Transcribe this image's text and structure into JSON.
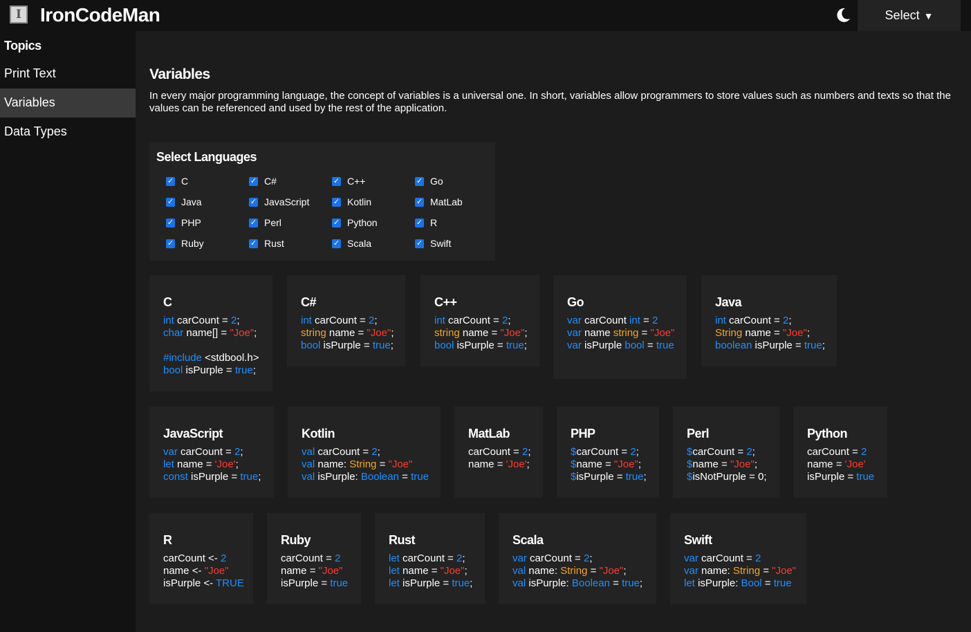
{
  "header": {
    "logo_letter": "I",
    "site_title": "IronCodeMan",
    "select_label": "Select",
    "select_caret": "▼",
    "theme_icon": "moon-icon"
  },
  "sidebar": {
    "heading": "Topics",
    "items": [
      {
        "label": "Print Text",
        "active": false
      },
      {
        "label": "Variables",
        "active": true
      },
      {
        "label": "Data Types",
        "active": false
      }
    ]
  },
  "main": {
    "title": "Variables",
    "intro": "In every major programming language, the concept of variables is a universal one. In short, variables allow programmers to store values such as numbers and texts so that the values can be referenced and used by the rest of the application."
  },
  "languages": {
    "title": "Select Languages",
    "options": [
      {
        "label": "C",
        "checked": true
      },
      {
        "label": "C#",
        "checked": true
      },
      {
        "label": "C++",
        "checked": true
      },
      {
        "label": "Go",
        "checked": true
      },
      {
        "label": "Java",
        "checked": true
      },
      {
        "label": "JavaScript",
        "checked": true
      },
      {
        "label": "Kotlin",
        "checked": true
      },
      {
        "label": "MatLab",
        "checked": true
      },
      {
        "label": "PHP",
        "checked": true
      },
      {
        "label": "Perl",
        "checked": true
      },
      {
        "label": "Python",
        "checked": true
      },
      {
        "label": "R",
        "checked": true
      },
      {
        "label": "Ruby",
        "checked": true
      },
      {
        "label": "Rust",
        "checked": true
      },
      {
        "label": "Scala",
        "checked": true
      },
      {
        "label": "Swift",
        "checked": true
      }
    ]
  },
  "colors": {
    "keyword": "#1e90ff",
    "string": "#ff3b30",
    "type": "#f5a623",
    "checkbox": "#1a73e8"
  },
  "cards": [
    {
      "name": "C",
      "lines": [
        [
          [
            "kw",
            "int"
          ],
          [
            "t",
            " carCount = "
          ],
          [
            "kw",
            "2"
          ],
          [
            "t",
            ";"
          ]
        ],
        [
          [
            "kw",
            "char"
          ],
          [
            "t",
            " name[] = "
          ],
          [
            "str",
            "\"Joe\""
          ],
          [
            "t",
            ";"
          ]
        ],
        [],
        [
          [
            "kw",
            "#include"
          ],
          [
            "t",
            " <stdbool.h>"
          ]
        ],
        [
          [
            "kw",
            "bool"
          ],
          [
            "t",
            " isPurple = "
          ],
          [
            "kw",
            "true"
          ],
          [
            "t",
            ";"
          ]
        ]
      ]
    },
    {
      "name": "C#",
      "lines": [
        [
          [
            "kw",
            "int"
          ],
          [
            "t",
            " carCount = "
          ],
          [
            "kw",
            "2"
          ],
          [
            "t",
            ";"
          ]
        ],
        [
          [
            "typ",
            "string"
          ],
          [
            "t",
            " name = "
          ],
          [
            "str",
            "\"Joe\""
          ],
          [
            "t",
            ";"
          ]
        ],
        [
          [
            "kw",
            "bool"
          ],
          [
            "t",
            " isPurple = "
          ],
          [
            "kw",
            "true"
          ],
          [
            "t",
            ";"
          ]
        ]
      ]
    },
    {
      "name": "C++",
      "lines": [
        [
          [
            "kw",
            "int"
          ],
          [
            "t",
            " carCount = "
          ],
          [
            "kw",
            "2"
          ],
          [
            "t",
            ";"
          ]
        ],
        [
          [
            "typ",
            "string"
          ],
          [
            "t",
            " name = "
          ],
          [
            "str",
            "\"Joe\""
          ],
          [
            "t",
            ";"
          ]
        ],
        [
          [
            "kw",
            "bool"
          ],
          [
            "t",
            " isPurple = "
          ],
          [
            "kw",
            "true"
          ],
          [
            "t",
            ";"
          ]
        ]
      ]
    },
    {
      "name": "Go",
      "lines": [
        [
          [
            "kw",
            "var"
          ],
          [
            "t",
            " carCount "
          ],
          [
            "kw",
            "int"
          ],
          [
            "t",
            " = "
          ],
          [
            "kw",
            "2"
          ]
        ],
        [
          [
            "kw",
            "var"
          ],
          [
            "t",
            " name "
          ],
          [
            "typ",
            "string"
          ],
          [
            "t",
            " = "
          ],
          [
            "str",
            "\"Joe\""
          ]
        ],
        [
          [
            "kw",
            "var"
          ],
          [
            "t",
            " isPurple "
          ],
          [
            "kw",
            "bool"
          ],
          [
            "t",
            " = "
          ],
          [
            "kw",
            "true"
          ]
        ]
      ]
    },
    {
      "name": "Java",
      "lines": [
        [
          [
            "kw",
            "int"
          ],
          [
            "t",
            " carCount = "
          ],
          [
            "kw",
            "2"
          ],
          [
            "t",
            ";"
          ]
        ],
        [
          [
            "typ",
            "String"
          ],
          [
            "t",
            " name = "
          ],
          [
            "str",
            "\"Joe\""
          ],
          [
            "t",
            ";"
          ]
        ],
        [
          [
            "kw",
            "boolean"
          ],
          [
            "t",
            " isPurple = "
          ],
          [
            "kw",
            "true"
          ],
          [
            "t",
            ";"
          ]
        ]
      ]
    },
    {
      "name": "JavaScript",
      "lines": [
        [
          [
            "kw",
            "var"
          ],
          [
            "t",
            " carCount = "
          ],
          [
            "kw",
            "2"
          ],
          [
            "t",
            ";"
          ]
        ],
        [
          [
            "kw",
            "let"
          ],
          [
            "t",
            " name = "
          ],
          [
            "str",
            "'Joe'"
          ],
          [
            "t",
            ";"
          ]
        ],
        [
          [
            "kw",
            "const"
          ],
          [
            "t",
            " isPurple = "
          ],
          [
            "kw",
            "true"
          ],
          [
            "t",
            ";"
          ]
        ]
      ]
    },
    {
      "name": "Kotlin",
      "lines": [
        [
          [
            "kw",
            "val"
          ],
          [
            "t",
            " carCount = "
          ],
          [
            "kw",
            "2"
          ],
          [
            "t",
            ";"
          ]
        ],
        [
          [
            "kw",
            "val"
          ],
          [
            "t",
            " name: "
          ],
          [
            "typ",
            "String"
          ],
          [
            "t",
            " = "
          ],
          [
            "str",
            "\"Joe\""
          ]
        ],
        [
          [
            "kw",
            "val"
          ],
          [
            "t",
            " isPurple: "
          ],
          [
            "kw",
            "Boolean"
          ],
          [
            "t",
            " = "
          ],
          [
            "kw",
            "true"
          ]
        ]
      ]
    },
    {
      "name": "MatLab",
      "lines": [
        [
          [
            "t",
            "carCount = "
          ],
          [
            "kw",
            "2"
          ],
          [
            "t",
            ";"
          ]
        ],
        [
          [
            "t",
            "name = "
          ],
          [
            "str",
            "'Joe'"
          ],
          [
            "t",
            ";"
          ]
        ]
      ]
    },
    {
      "name": "PHP",
      "lines": [
        [
          [
            "kw",
            "$"
          ],
          [
            "t",
            "carCount = "
          ],
          [
            "kw",
            "2"
          ],
          [
            "t",
            ";"
          ]
        ],
        [
          [
            "kw",
            "$"
          ],
          [
            "t",
            "name = "
          ],
          [
            "str",
            "\"Joe\""
          ],
          [
            "t",
            ";"
          ]
        ],
        [
          [
            "kw",
            "$"
          ],
          [
            "t",
            "isPurple = "
          ],
          [
            "kw",
            "true"
          ],
          [
            "t",
            ";"
          ]
        ]
      ]
    },
    {
      "name": "Perl",
      "lines": [
        [
          [
            "kw",
            "$"
          ],
          [
            "t",
            "carCount = "
          ],
          [
            "kw",
            "2"
          ],
          [
            "t",
            ";"
          ]
        ],
        [
          [
            "kw",
            "$"
          ],
          [
            "t",
            "name = "
          ],
          [
            "str",
            "\"Joe\""
          ],
          [
            "t",
            ";"
          ]
        ],
        [
          [
            "kw",
            "$"
          ],
          [
            "t",
            "isNotPurple = 0;"
          ]
        ]
      ]
    },
    {
      "name": "Python",
      "lines": [
        [
          [
            "t",
            "carCount = "
          ],
          [
            "kw",
            "2"
          ]
        ],
        [
          [
            "t",
            "name = "
          ],
          [
            "str",
            "'Joe'"
          ]
        ],
        [
          [
            "t",
            "isPurple = "
          ],
          [
            "kw",
            "true"
          ]
        ]
      ]
    },
    {
      "name": "R",
      "lines": [
        [
          [
            "t",
            "carCount <- "
          ],
          [
            "kw",
            "2"
          ]
        ],
        [
          [
            "t",
            "name <- "
          ],
          [
            "str",
            "\"Joe\""
          ]
        ],
        [
          [
            "t",
            "isPurple <- "
          ],
          [
            "kw",
            "TRUE"
          ]
        ]
      ]
    },
    {
      "name": "Ruby",
      "lines": [
        [
          [
            "t",
            "carCount = "
          ],
          [
            "kw",
            "2"
          ]
        ],
        [
          [
            "t",
            "name = "
          ],
          [
            "str",
            "\"Joe\""
          ]
        ],
        [
          [
            "t",
            "isPurple = "
          ],
          [
            "kw",
            "true"
          ]
        ]
      ]
    },
    {
      "name": "Rust",
      "lines": [
        [
          [
            "kw",
            "let"
          ],
          [
            "t",
            " carCount = "
          ],
          [
            "kw",
            "2"
          ],
          [
            "t",
            ";"
          ]
        ],
        [
          [
            "kw",
            "let"
          ],
          [
            "t",
            " name = "
          ],
          [
            "str",
            "\"Joe\""
          ],
          [
            "t",
            ";"
          ]
        ],
        [
          [
            "kw",
            "let"
          ],
          [
            "t",
            " isPurple = "
          ],
          [
            "kw",
            "true"
          ],
          [
            "t",
            ";"
          ]
        ]
      ]
    },
    {
      "name": "Scala",
      "lines": [
        [
          [
            "kw",
            "var"
          ],
          [
            "t",
            " carCount = "
          ],
          [
            "kw",
            "2"
          ],
          [
            "t",
            ";"
          ]
        ],
        [
          [
            "kw",
            "val"
          ],
          [
            "t",
            " name: "
          ],
          [
            "typ",
            "String"
          ],
          [
            "t",
            " = "
          ],
          [
            "str",
            "\"Joe\""
          ],
          [
            "t",
            ";"
          ]
        ],
        [
          [
            "kw",
            "val"
          ],
          [
            "t",
            " isPurple: "
          ],
          [
            "kw",
            "Boolean"
          ],
          [
            "t",
            " = "
          ],
          [
            "kw",
            "true"
          ],
          [
            "t",
            ";"
          ]
        ]
      ]
    },
    {
      "name": "Swift",
      "lines": [
        [
          [
            "kw",
            "var"
          ],
          [
            "t",
            " carCount = "
          ],
          [
            "kw",
            "2"
          ]
        ],
        [
          [
            "kw",
            "var"
          ],
          [
            "t",
            " name: "
          ],
          [
            "typ",
            "String"
          ],
          [
            "t",
            " = "
          ],
          [
            "str",
            "\"Joe\""
          ]
        ],
        [
          [
            "kw",
            "let"
          ],
          [
            "t",
            " isPurple: "
          ],
          [
            "kw",
            "Bool"
          ],
          [
            "t",
            " = "
          ],
          [
            "kw",
            "true"
          ]
        ]
      ]
    }
  ]
}
